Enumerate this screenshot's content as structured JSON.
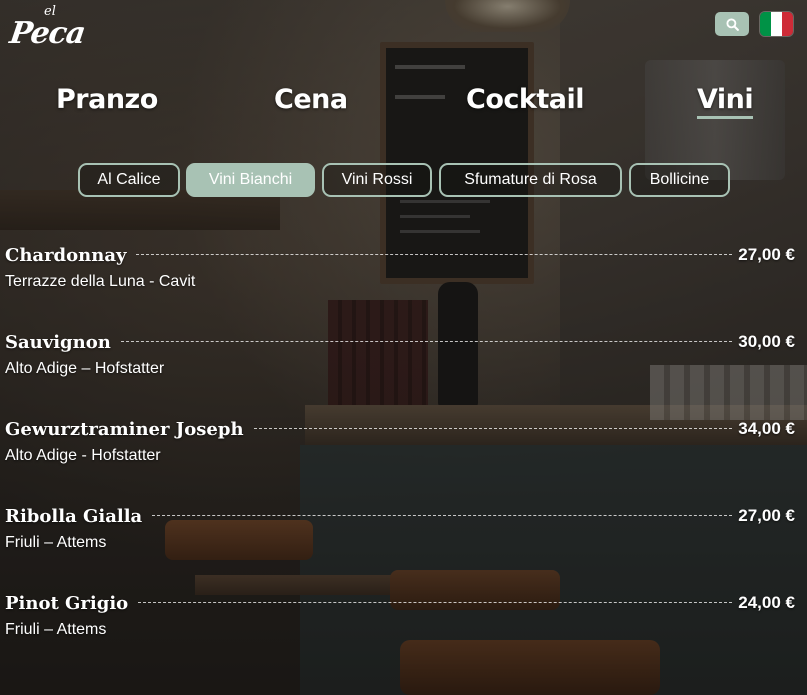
{
  "brand": {
    "logo_prefix": "el",
    "logo_name": "Peca"
  },
  "header": {
    "search_icon": "search-icon",
    "language_flag": {
      "name": "italian-flag-icon",
      "colors": [
        "#009246",
        "#ffffff",
        "#ce2b37"
      ]
    }
  },
  "colors": {
    "accent": "#a8c2b4"
  },
  "main_nav": [
    {
      "label": "Pranzo",
      "active": false
    },
    {
      "label": "Cena",
      "active": false
    },
    {
      "label": "Cocktail",
      "active": false
    },
    {
      "label": "Vini",
      "active": true
    }
  ],
  "tabs": [
    {
      "label": "Al Calice",
      "active": false
    },
    {
      "label": "Vini Bianchi",
      "active": true
    },
    {
      "label": "Vini Rossi",
      "active": false
    },
    {
      "label": "Sfumature di Rosa",
      "active": false
    },
    {
      "label": "Bollicine",
      "active": false
    }
  ],
  "wines": [
    {
      "name": "Chardonnay",
      "price": "27,00 €",
      "description": "Terrazze della Luna - Cavit"
    },
    {
      "name": "Sauvignon",
      "price": "30,00 €",
      "description": "Alto Adige – Hofstatter"
    },
    {
      "name": "Gewurztraminer Joseph",
      "price": "34,00 €",
      "description": "Alto Adige - Hofstatter"
    },
    {
      "name": "Ribolla Gialla",
      "price": "27,00 €",
      "description": "Friuli – Attems"
    },
    {
      "name": "Pinot Grigio",
      "price": "24,00 €",
      "description": "Friuli – Attems"
    }
  ]
}
